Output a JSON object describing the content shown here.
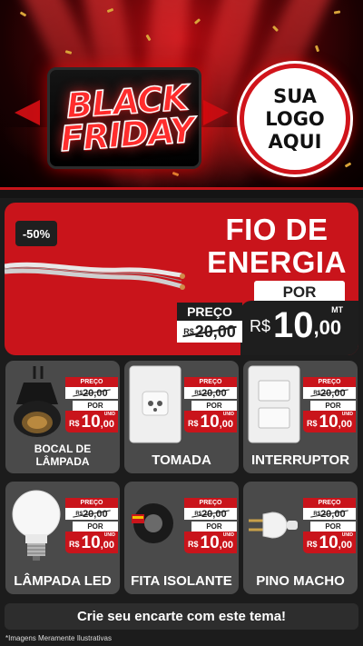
{
  "hero": {
    "word1": "BLACK",
    "word2": "FRIDAY",
    "logo_lines": [
      "SUA",
      "LOGO",
      "AQUI"
    ]
  },
  "featured": {
    "discount": "-50%",
    "title_line1": "FIO DE",
    "title_line2": "ENERGIA",
    "por": "POR",
    "preco_label": "PREÇO",
    "old_currency": "R$",
    "old_price": "20,00",
    "currency": "R$",
    "price_int": "10",
    "price_dec": ",00",
    "unit": "MT"
  },
  "product_tag": {
    "preco_label": "PREÇO",
    "por_label": "POR",
    "currency": "R$",
    "unit": "UNID"
  },
  "products": [
    {
      "name": "BOCAL DE LÂMPADA",
      "old_price": "20,00",
      "price_int": "10",
      "price_dec": ",00",
      "icon": "lamp-socket-icon"
    },
    {
      "name": "TOMADA",
      "old_price": "20,00",
      "price_int": "10",
      "price_dec": ",00",
      "icon": "power-outlet-icon"
    },
    {
      "name": "INTERRUPTOR",
      "old_price": "20,00",
      "price_int": "10",
      "price_dec": ",00",
      "icon": "light-switch-icon"
    },
    {
      "name": "LÂMPADA LED",
      "old_price": "20,00",
      "price_int": "10",
      "price_dec": ",00",
      "icon": "led-bulb-icon"
    },
    {
      "name": "FITA ISOLANTE",
      "old_price": "20,00",
      "price_int": "10",
      "price_dec": ",00",
      "icon": "insulating-tape-icon"
    },
    {
      "name": "PINO MACHO",
      "old_price": "20,00",
      "price_int": "10",
      "price_dec": ",00",
      "icon": "male-plug-icon"
    }
  ],
  "cta": "Crie seu encarte com este tema!",
  "footnote": "*Imagens Meramente Ilustrativas",
  "colors": {
    "brand_red": "#c9141b",
    "card_bg": "#4a4a4a",
    "page_bg": "#1c1c1c"
  }
}
